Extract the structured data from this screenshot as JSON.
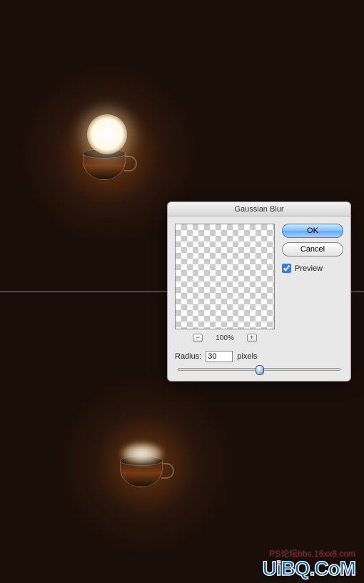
{
  "dialog": {
    "title": "Gaussian Blur",
    "ok": "OK",
    "cancel": "Cancel",
    "preview_label": "Preview",
    "preview_checked": true,
    "zoom": "100%",
    "zoom_out_symbol": "−",
    "zoom_in_symbol": "+",
    "radius_label": "Radius:",
    "radius_value": "30",
    "radius_unit": "pixels"
  },
  "watermarks": {
    "small": "PS论坛bbs.16xx8.com",
    "large": "UiBQ.CoM"
  }
}
